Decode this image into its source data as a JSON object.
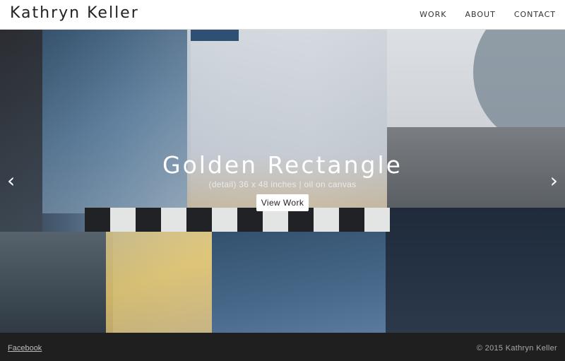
{
  "header": {
    "brand": "Kathryn Keller",
    "nav": [
      "WORK",
      "ABOUT",
      "CONTACT"
    ]
  },
  "slider": {
    "title": "Golden Rectangle",
    "subtitle": "(detail) 36 x 48 inches | oil on canvas",
    "button_label": "View Work",
    "prev_icon": "chevron-left-icon",
    "next_icon": "chevron-right-icon"
  },
  "footer": {
    "link": "Facebook",
    "copyright": "© 2015 Kathryn Keller"
  }
}
